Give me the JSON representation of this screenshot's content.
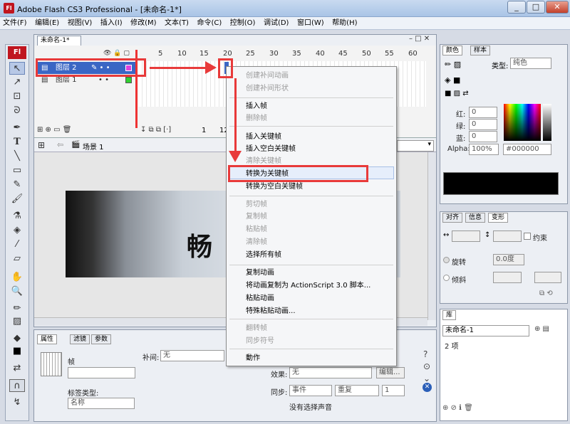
{
  "window": {
    "title": "Adobe Flash CS3 Professional - [未命名-1*]",
    "app_icon": "Fl",
    "min": "_",
    "max": "□",
    "close": "✕"
  },
  "menubar": [
    "文件(F)",
    "编辑(E)",
    "视图(V)",
    "插入(I)",
    "修改(M)",
    "文本(T)",
    "命令(C)",
    "控制(O)",
    "调试(D)",
    "窗口(W)",
    "帮助(H)"
  ],
  "toolbox": {
    "logo": "Fl"
  },
  "document": {
    "tab": "未命名-1*"
  },
  "timeline": {
    "frame_numbers": [
      "5",
      "10",
      "15",
      "20",
      "25",
      "30",
      "35",
      "40",
      "45",
      "50",
      "55",
      "60"
    ],
    "layers": [
      {
        "name": "图层 2"
      },
      {
        "name": "图层 1"
      }
    ],
    "status": {
      "frame": "1",
      "fps": "12"
    }
  },
  "scene": {
    "label": "场景 1"
  },
  "stage": {
    "brush_text": "畅"
  },
  "context_menu": {
    "items": [
      {
        "label": "创建补间动画",
        "enabled": false
      },
      {
        "label": "创建补间形状",
        "enabled": false
      },
      {
        "label": "插入帧",
        "enabled": true
      },
      {
        "label": "删除帧",
        "enabled": false
      },
      {
        "label": "插入关键帧",
        "enabled": true
      },
      {
        "label": "插入空白关键帧",
        "enabled": true
      },
      {
        "label": "清除关键帧",
        "enabled": false
      },
      {
        "label": "转换为关键帧",
        "enabled": true
      },
      {
        "label": "转换为空白关键帧",
        "enabled": true
      },
      {
        "label": "剪切帧",
        "enabled": false
      },
      {
        "label": "复制帧",
        "enabled": false
      },
      {
        "label": "粘贴帧",
        "enabled": false
      },
      {
        "label": "清除帧",
        "enabled": false
      },
      {
        "label": "选择所有帧",
        "enabled": true
      },
      {
        "label": "复制动画",
        "enabled": true
      },
      {
        "label": "将动画复制为 ActionScript 3.0 脚本...",
        "enabled": true
      },
      {
        "label": "粘贴动画",
        "enabled": true
      },
      {
        "label": "特殊粘贴动画...",
        "enabled": true
      },
      {
        "label": "翻转帧",
        "enabled": false
      },
      {
        "label": "同步符号",
        "enabled": false
      },
      {
        "label": "動作",
        "enabled": true
      }
    ]
  },
  "properties": {
    "tabs": [
      "属性",
      "滤镜",
      "参数"
    ],
    "frame_label": "帧",
    "tween_label": "补间:",
    "tween_value": "无",
    "label_type_label": "标签类型:",
    "label_type_value": "名称",
    "effect_label": "效果:",
    "effect_value": "无",
    "edit_button": "编辑...",
    "sync_label": "同步:",
    "sync_value": "事件",
    "repeat_value": "重复",
    "repeat_count": "1",
    "no_sound": "没有选择声音"
  },
  "color_panel": {
    "tabs": [
      "颜色",
      "样本"
    ],
    "type_label": "类型:",
    "type_value": "纯色",
    "red_label": "红:",
    "red_value": "0",
    "green_label": "绿:",
    "green_value": "0",
    "blue_label": "蓝:",
    "blue_value": "0",
    "alpha_label": "Alpha:",
    "alpha_value": "100%",
    "hex_value": "#000000",
    "swatch_color": "#000000"
  },
  "transform_panel": {
    "tabs": [
      "对齐",
      "信息",
      "变形"
    ],
    "constrain": "约束",
    "rotate": "旋转",
    "rotate_value": "0.0度",
    "skew": "倾斜"
  },
  "library_panel": {
    "tab": "库",
    "doc": "未命名-1",
    "count": "2 项"
  },
  "colors": {
    "accent_red": "#e83a3a"
  }
}
